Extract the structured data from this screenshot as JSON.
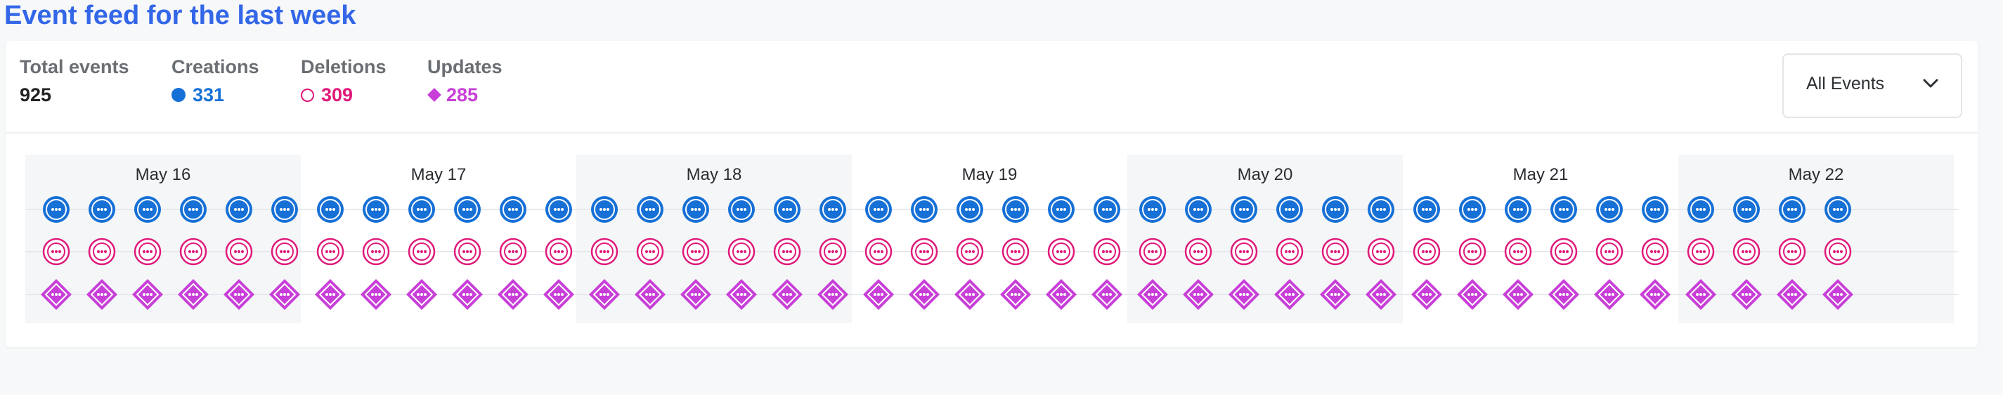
{
  "page": {
    "title": "Event feed for the last week"
  },
  "stats": {
    "total": {
      "label": "Total events",
      "value": "925"
    },
    "creations": {
      "label": "Creations",
      "value": "331",
      "color": "#1670d6",
      "icon": "filled-circle-icon"
    },
    "deletions": {
      "label": "Deletions",
      "value": "309",
      "color": "#e0197a",
      "icon": "hollow-circle-icon"
    },
    "updates": {
      "label": "Updates",
      "value": "285",
      "color": "#c83fd8",
      "icon": "diamond-icon"
    }
  },
  "filter": {
    "selected": "All Events",
    "icon": "chevron-down-icon"
  },
  "timeline": {
    "days": [
      "May 16",
      "May 17",
      "May 18",
      "May 19",
      "May 20",
      "May 21",
      "May 22"
    ],
    "rows": [
      {
        "type": "creation",
        "color": "#1670d6",
        "icon": "ellipsis-icon",
        "marker": "filled-circle"
      },
      {
        "type": "deletion",
        "color": "#e0197a",
        "icon": "ellipsis-icon",
        "marker": "double-ring"
      },
      {
        "type": "update",
        "color": "#c83fd8",
        "icon": "ellipsis-icon",
        "marker": "diamond"
      }
    ],
    "markers_per_day": [
      6,
      6,
      6,
      6,
      6,
      6,
      4
    ]
  }
}
